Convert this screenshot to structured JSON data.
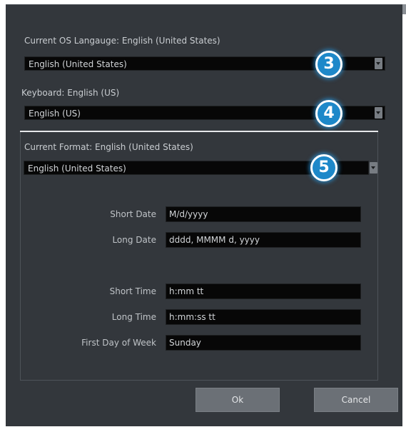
{
  "language": {
    "current_label": "Current OS Langauge: English (United States)",
    "value": "English (United States)",
    "callout": "3"
  },
  "keyboard": {
    "current_label": "Keyboard: English (US)",
    "value": "English (US)",
    "callout": "4"
  },
  "format": {
    "current_label": "Current Format: English (United States)",
    "value": "English (United States)",
    "callout": "5",
    "fields": {
      "short_date": {
        "label": "Short Date",
        "value": "M/d/yyyy"
      },
      "long_date": {
        "label": "Long Date",
        "value": "dddd, MMMM d, yyyy"
      },
      "short_time": {
        "label": "Short Time",
        "value": "h:mm tt"
      },
      "long_time": {
        "label": "Long Time",
        "value": "h:mm:ss tt"
      },
      "first_day": {
        "label": "First Day of Week",
        "value": "Sunday"
      }
    }
  },
  "buttons": {
    "ok": "Ok",
    "cancel": "Cancel"
  },
  "colors": {
    "dialog_bg": "#33373c",
    "callout_blue": "#1d88c9"
  }
}
